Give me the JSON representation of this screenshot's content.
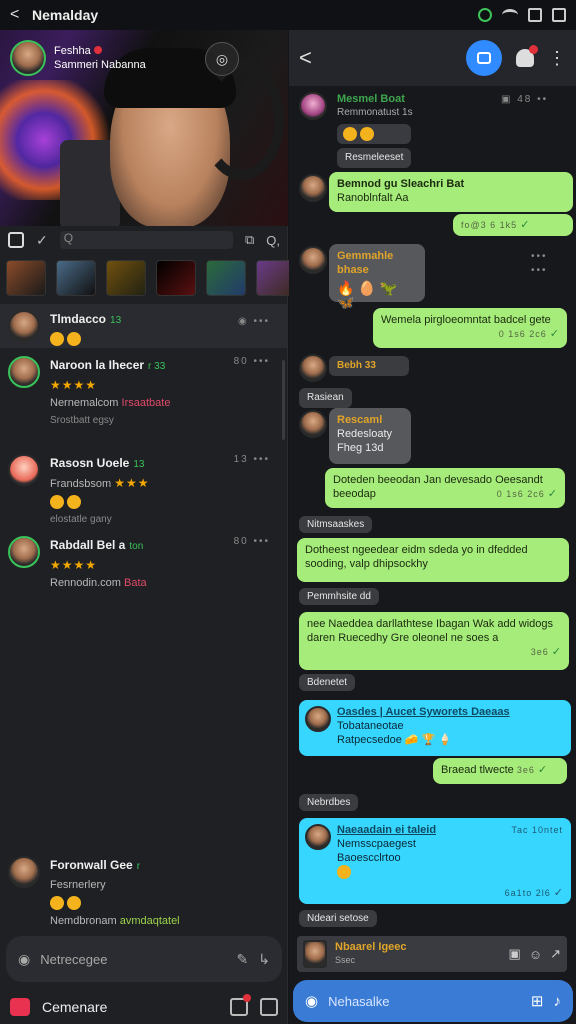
{
  "statusbar": {
    "back": "<",
    "title": "Nemalday"
  },
  "left": {
    "stream": {
      "name1": "Feshha",
      "name2": "Sammeri Nabanna",
      "cam_icon": "camera-icon"
    },
    "toolbar": {
      "search_text": "Q",
      "ctrl1": "⧉",
      "ctrl2": "Q,"
    },
    "rows": [
      {
        "name": "Tlmdacco",
        "tag": "13",
        "meta": "◉ ••• ",
        "line2": "",
        "sub": "",
        "emoji_line": true
      },
      {
        "name": "Naroon la Ihecer",
        "tag": "r 33",
        "stars": "★★★★",
        "desc": "Nernemalcom",
        "desc_hl": "Irsaatbate",
        "sub": "Srostbatt egsy",
        "meta": "80 •••"
      },
      {
        "name": "Rasosn Uoele",
        "tag": "13",
        "stars": "★★★",
        "desc": "Frandsbsom",
        "desc_hl": "",
        "sub": "elostatle gany",
        "meta": "13 •••"
      },
      {
        "name": "Rabdall Bel a",
        "tag": "ton",
        "stars": "★★★★",
        "desc": "Rennodin.com",
        "desc_hl": "Bata",
        "sub": "",
        "meta": "80 •••"
      },
      {
        "name": "Foronwall Gee",
        "tag": "r",
        "stars": "",
        "desc": "Fesrnerlery",
        "desc_hlg": "avmdaqtatel",
        "desc2": "Nemdbronam",
        "sub": "",
        "meta": ""
      }
    ],
    "compose_placeholder": "Netrecegee",
    "bottom_label": "Cemenare"
  },
  "right": {
    "header": {
      "back": "<",
      "more": "⋮"
    },
    "messages": [
      {
        "sender": "Mesmel Boat",
        "line1": "Remmonatust  1s",
        "tag": "Resmeleeset"
      },
      {
        "sender": "Bemnod gu Sleachri Bat",
        "text": "Ranoblnfalt Aa",
        "time": "fo@3 6 1k5"
      },
      {
        "sender": "Gemmahle bhase",
        "emojis": "🔥 🥚 🦖 🦋"
      },
      {
        "text": "Wemela pirgloeomntat badcel gete",
        "time": "0 1s6 2c6"
      },
      {
        "sender": "Bebh 33",
        "tag": "Rasiean"
      },
      {
        "sender": "Rescaml",
        "text1": "Redesloaty",
        "text2": "Fheg 13d"
      },
      {
        "text": "Doteden beeodan Jan devesado Oeesandt beeodap",
        "time": "0 1s6 2c6"
      },
      {
        "tag": "Nitmsaaskes"
      },
      {
        "text": "Dotheest ngeedear eidm sdeda yo in dfedded sooding, valp dhipsockhy"
      },
      {
        "tag": "Pemmhsite dd"
      },
      {
        "text": "nee Naeddea darllathtese Ibagan Wak add widogs daren Ruecedhy Gre oleonel ne soes a",
        "time": "3e6"
      },
      {
        "tag": "Bdenetet"
      },
      {
        "sender": "Oasdes | Aucet Syworets Daeaas",
        "text1": "Tobataneotae",
        "text2": "Ratpecsedoe",
        "emojis": "🧀 🏆 🍦"
      },
      {
        "text": "Braead tlwecte",
        "time": "3e6"
      },
      {
        "tag": "Nebrdbes"
      },
      {
        "sender": "Naeaadain ei taleid",
        "text1": "Nemsscpaegest",
        "text2": "Baoescclrtoo",
        "time": "Tac 10ntet",
        "time2": "6a1to 2l6"
      },
      {
        "tag": "Ndeari setose"
      }
    ],
    "compose_top": {
      "name": "Nbaarel Igeec",
      "sub": "Ssec"
    },
    "compose_placeholder": "Nehasalke"
  },
  "colors": {
    "accent": "#2f8bff",
    "green_bubble": "#a6ec7a",
    "cyan_bubble": "#36d6ff",
    "live": "#e0303a"
  }
}
